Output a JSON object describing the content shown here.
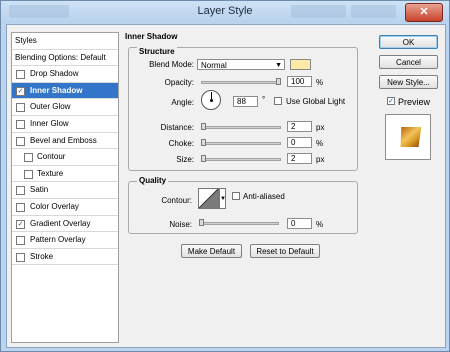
{
  "window": {
    "title": "Layer Style",
    "close_glyph": "✕"
  },
  "sidebar": {
    "items": [
      {
        "label": "Styles",
        "checkbox": false,
        "checked": false,
        "selected": false,
        "indent": false
      },
      {
        "label": "Blending Options: Default",
        "checkbox": false,
        "checked": false,
        "selected": false,
        "indent": false
      },
      {
        "label": "Drop Shadow",
        "checkbox": true,
        "checked": false,
        "selected": false,
        "indent": false
      },
      {
        "label": "Inner Shadow",
        "checkbox": true,
        "checked": true,
        "selected": true,
        "indent": false
      },
      {
        "label": "Outer Glow",
        "checkbox": true,
        "checked": false,
        "selected": false,
        "indent": false
      },
      {
        "label": "Inner Glow",
        "checkbox": true,
        "checked": false,
        "selected": false,
        "indent": false
      },
      {
        "label": "Bevel and Emboss",
        "checkbox": true,
        "checked": false,
        "selected": false,
        "indent": false
      },
      {
        "label": "Contour",
        "checkbox": true,
        "checked": false,
        "selected": false,
        "indent": true
      },
      {
        "label": "Texture",
        "checkbox": true,
        "checked": false,
        "selected": false,
        "indent": true
      },
      {
        "label": "Satin",
        "checkbox": true,
        "checked": false,
        "selected": false,
        "indent": false
      },
      {
        "label": "Color Overlay",
        "checkbox": true,
        "checked": false,
        "selected": false,
        "indent": false
      },
      {
        "label": "Gradient Overlay",
        "checkbox": true,
        "checked": true,
        "selected": false,
        "indent": false
      },
      {
        "label": "Pattern Overlay",
        "checkbox": true,
        "checked": false,
        "selected": false,
        "indent": false
      },
      {
        "label": "Stroke",
        "checkbox": true,
        "checked": false,
        "selected": false,
        "indent": false
      }
    ]
  },
  "inner_shadow": {
    "title": "Inner Shadow",
    "structure": {
      "title": "Structure",
      "blend_mode_label": "Blend Mode:",
      "blend_mode_value": "Normal",
      "shadow_color": "#fdeaa7",
      "opacity_label": "Opacity:",
      "opacity_value": "100",
      "opacity_fraction": 1.0,
      "opacity_unit": "%",
      "angle_label": "Angle:",
      "angle_value": "88",
      "angle_unit": "°",
      "use_global_light_label": "Use Global Light",
      "use_global_light_checked": false,
      "distance_label": "Distance:",
      "distance_value": "2",
      "distance_unit": "px",
      "choke_label": "Choke:",
      "choke_value": "0",
      "choke_unit": "%",
      "size_label": "Size:",
      "size_value": "2",
      "size_unit": "px"
    },
    "quality": {
      "title": "Quality",
      "contour_label": "Contour:",
      "anti_aliased_label": "Anti-aliased",
      "anti_aliased_checked": false,
      "noise_label": "Noise:",
      "noise_value": "0",
      "noise_unit": "%"
    },
    "make_default_label": "Make Default",
    "reset_default_label": "Reset to Default"
  },
  "actions": {
    "ok_label": "OK",
    "cancel_label": "Cancel",
    "new_style_label": "New Style...",
    "preview_label": "Preview",
    "preview_checked": true
  },
  "colors": {
    "selection_blue": "#3275c9",
    "preview_gold": "#d89a25"
  }
}
